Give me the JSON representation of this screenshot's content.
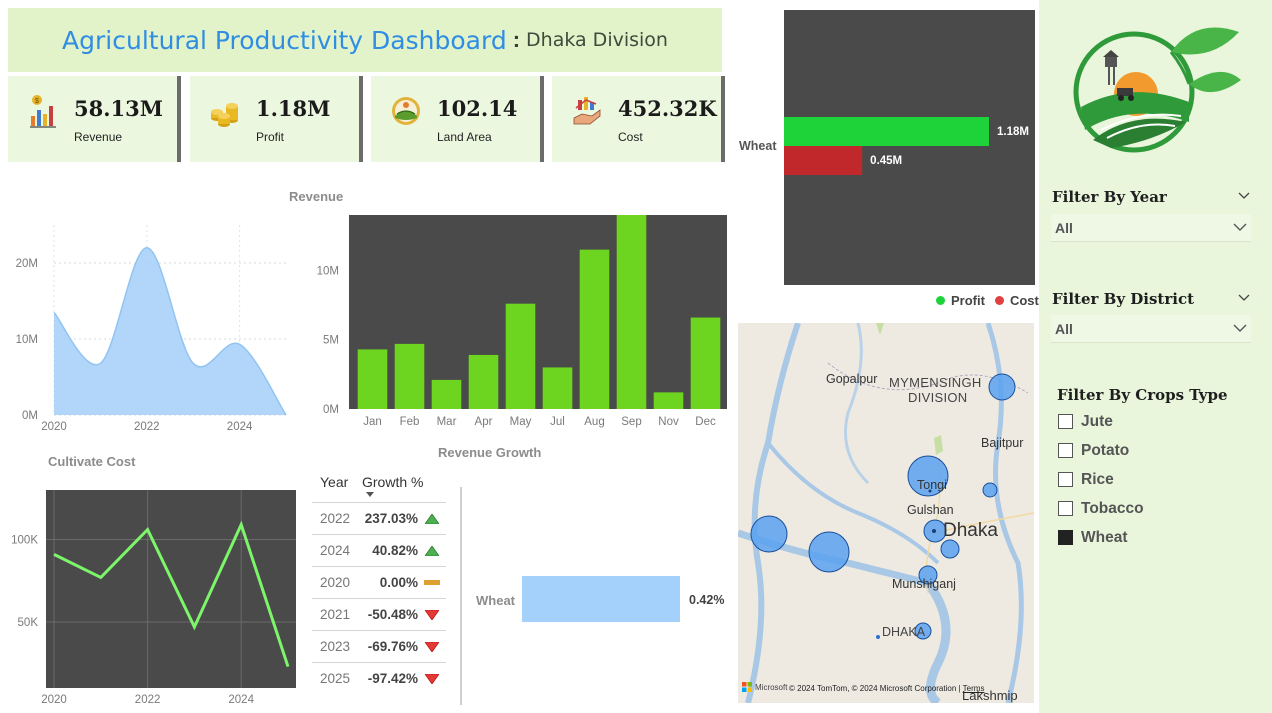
{
  "header": {
    "title": "Agricultural Productivity Dashboard",
    "separator": ":",
    "subtitle": "Dhaka Division"
  },
  "kpis": [
    {
      "value": "58.13M",
      "label": "Revenue",
      "icon": "revenue-chart-icon"
    },
    {
      "value": "1.18M",
      "label": "Profit",
      "icon": "coins-icon"
    },
    {
      "value": "102.14",
      "label": "Land Area",
      "icon": "field-icon"
    },
    {
      "value": "452.32K",
      "label": "Cost",
      "icon": "cost-hand-icon"
    }
  ],
  "area_chart": {
    "y_ticks": [
      "0M",
      "10M",
      "20M"
    ],
    "x_ticks": [
      "2020",
      "2022",
      "2024"
    ]
  },
  "revenue_chart": {
    "title": "Revenue",
    "y_ticks": [
      "0M",
      "5M",
      "10M"
    ]
  },
  "cost_chart": {
    "title": "Cultivate  Cost",
    "y_ticks": [
      "50K",
      "100K"
    ],
    "x_ticks": [
      "2020",
      "2022",
      "2024"
    ]
  },
  "growth_table": {
    "title": "Revenue Growth",
    "col_year": "Year",
    "col_growth": "Growth %",
    "rows": [
      {
        "year": "2022",
        "growth": "237.03%",
        "trend": "up"
      },
      {
        "year": "2024",
        "growth": "40.82%",
        "trend": "up"
      },
      {
        "year": "2020",
        "growth": "0.00%",
        "trend": "flat"
      },
      {
        "year": "2021",
        "growth": "-50.48%",
        "trend": "down"
      },
      {
        "year": "2023",
        "growth": "-69.76%",
        "trend": "down"
      },
      {
        "year": "2025",
        "growth": "-97.42%",
        "trend": "down"
      }
    ]
  },
  "growth_bar": {
    "category": "Wheat",
    "value_label": "0.42%"
  },
  "profit_cost": {
    "category": "Wheat",
    "profit_label": "1.18M",
    "cost_label": "0.45M",
    "legend_profit": "Profit",
    "legend_cost": "Cost",
    "colors": {
      "profit": "#1ed23a",
      "cost": "#c0282b"
    }
  },
  "map": {
    "labels": [
      "Gopalpur",
      "MYMENSINGH",
      "DIVISION",
      "Bajitpur",
      "Tongi",
      "Gulshan",
      "Dhaka",
      "Munshiganj",
      "DHAKA",
      "Lakshmip"
    ],
    "attribution": "© 2024 TomTom, © 2024 Microsoft Corporation",
    "terms": "Terms",
    "brand": "Microsoft"
  },
  "filters": {
    "year_title": "Filter By Year",
    "year_value": "All",
    "district_title": "Filter By District",
    "district_value": "All",
    "crops_title": "Filter By Crops Type",
    "crops": [
      {
        "label": "Jute",
        "checked": false
      },
      {
        "label": "Potato",
        "checked": false
      },
      {
        "label": "Rice",
        "checked": false
      },
      {
        "label": "Tobacco",
        "checked": false
      },
      {
        "label": "Wheat",
        "checked": true
      }
    ]
  },
  "chart_data": [
    {
      "type": "area",
      "x": [
        2020,
        2021,
        2022,
        2023,
        2024,
        2025
      ],
      "values": [
        13500000,
        6800000,
        22000000,
        6800000,
        9300000,
        0
      ],
      "ylim": [
        0,
        25000000
      ]
    },
    {
      "type": "bar",
      "title": "Revenue",
      "categories": [
        "Jan",
        "Feb",
        "Mar",
        "Apr",
        "May",
        "Jul",
        "Aug",
        "Sep",
        "Nov",
        "Dec"
      ],
      "values": [
        4300000,
        4700000,
        2100000,
        3900000,
        7600000,
        3000000,
        11500000,
        14000000,
        1200000,
        6600000
      ],
      "ylim": [
        0,
        14000000
      ]
    },
    {
      "type": "line",
      "title": "Cultivate  Cost",
      "x": [
        2020,
        2021,
        2022,
        2023,
        2024,
        2025
      ],
      "values": [
        91000,
        77000,
        106000,
        47000,
        109000,
        23000
      ],
      "ylim": [
        10000,
        130000
      ]
    },
    {
      "type": "bar",
      "title": "Revenue Growth",
      "categories": [
        "Wheat"
      ],
      "values": [
        0.42
      ]
    },
    {
      "type": "bar",
      "categories": [
        "Wheat"
      ],
      "series": [
        {
          "name": "Profit",
          "values": [
            1180000
          ]
        },
        {
          "name": "Cost",
          "values": [
            450000
          ]
        }
      ]
    }
  ]
}
